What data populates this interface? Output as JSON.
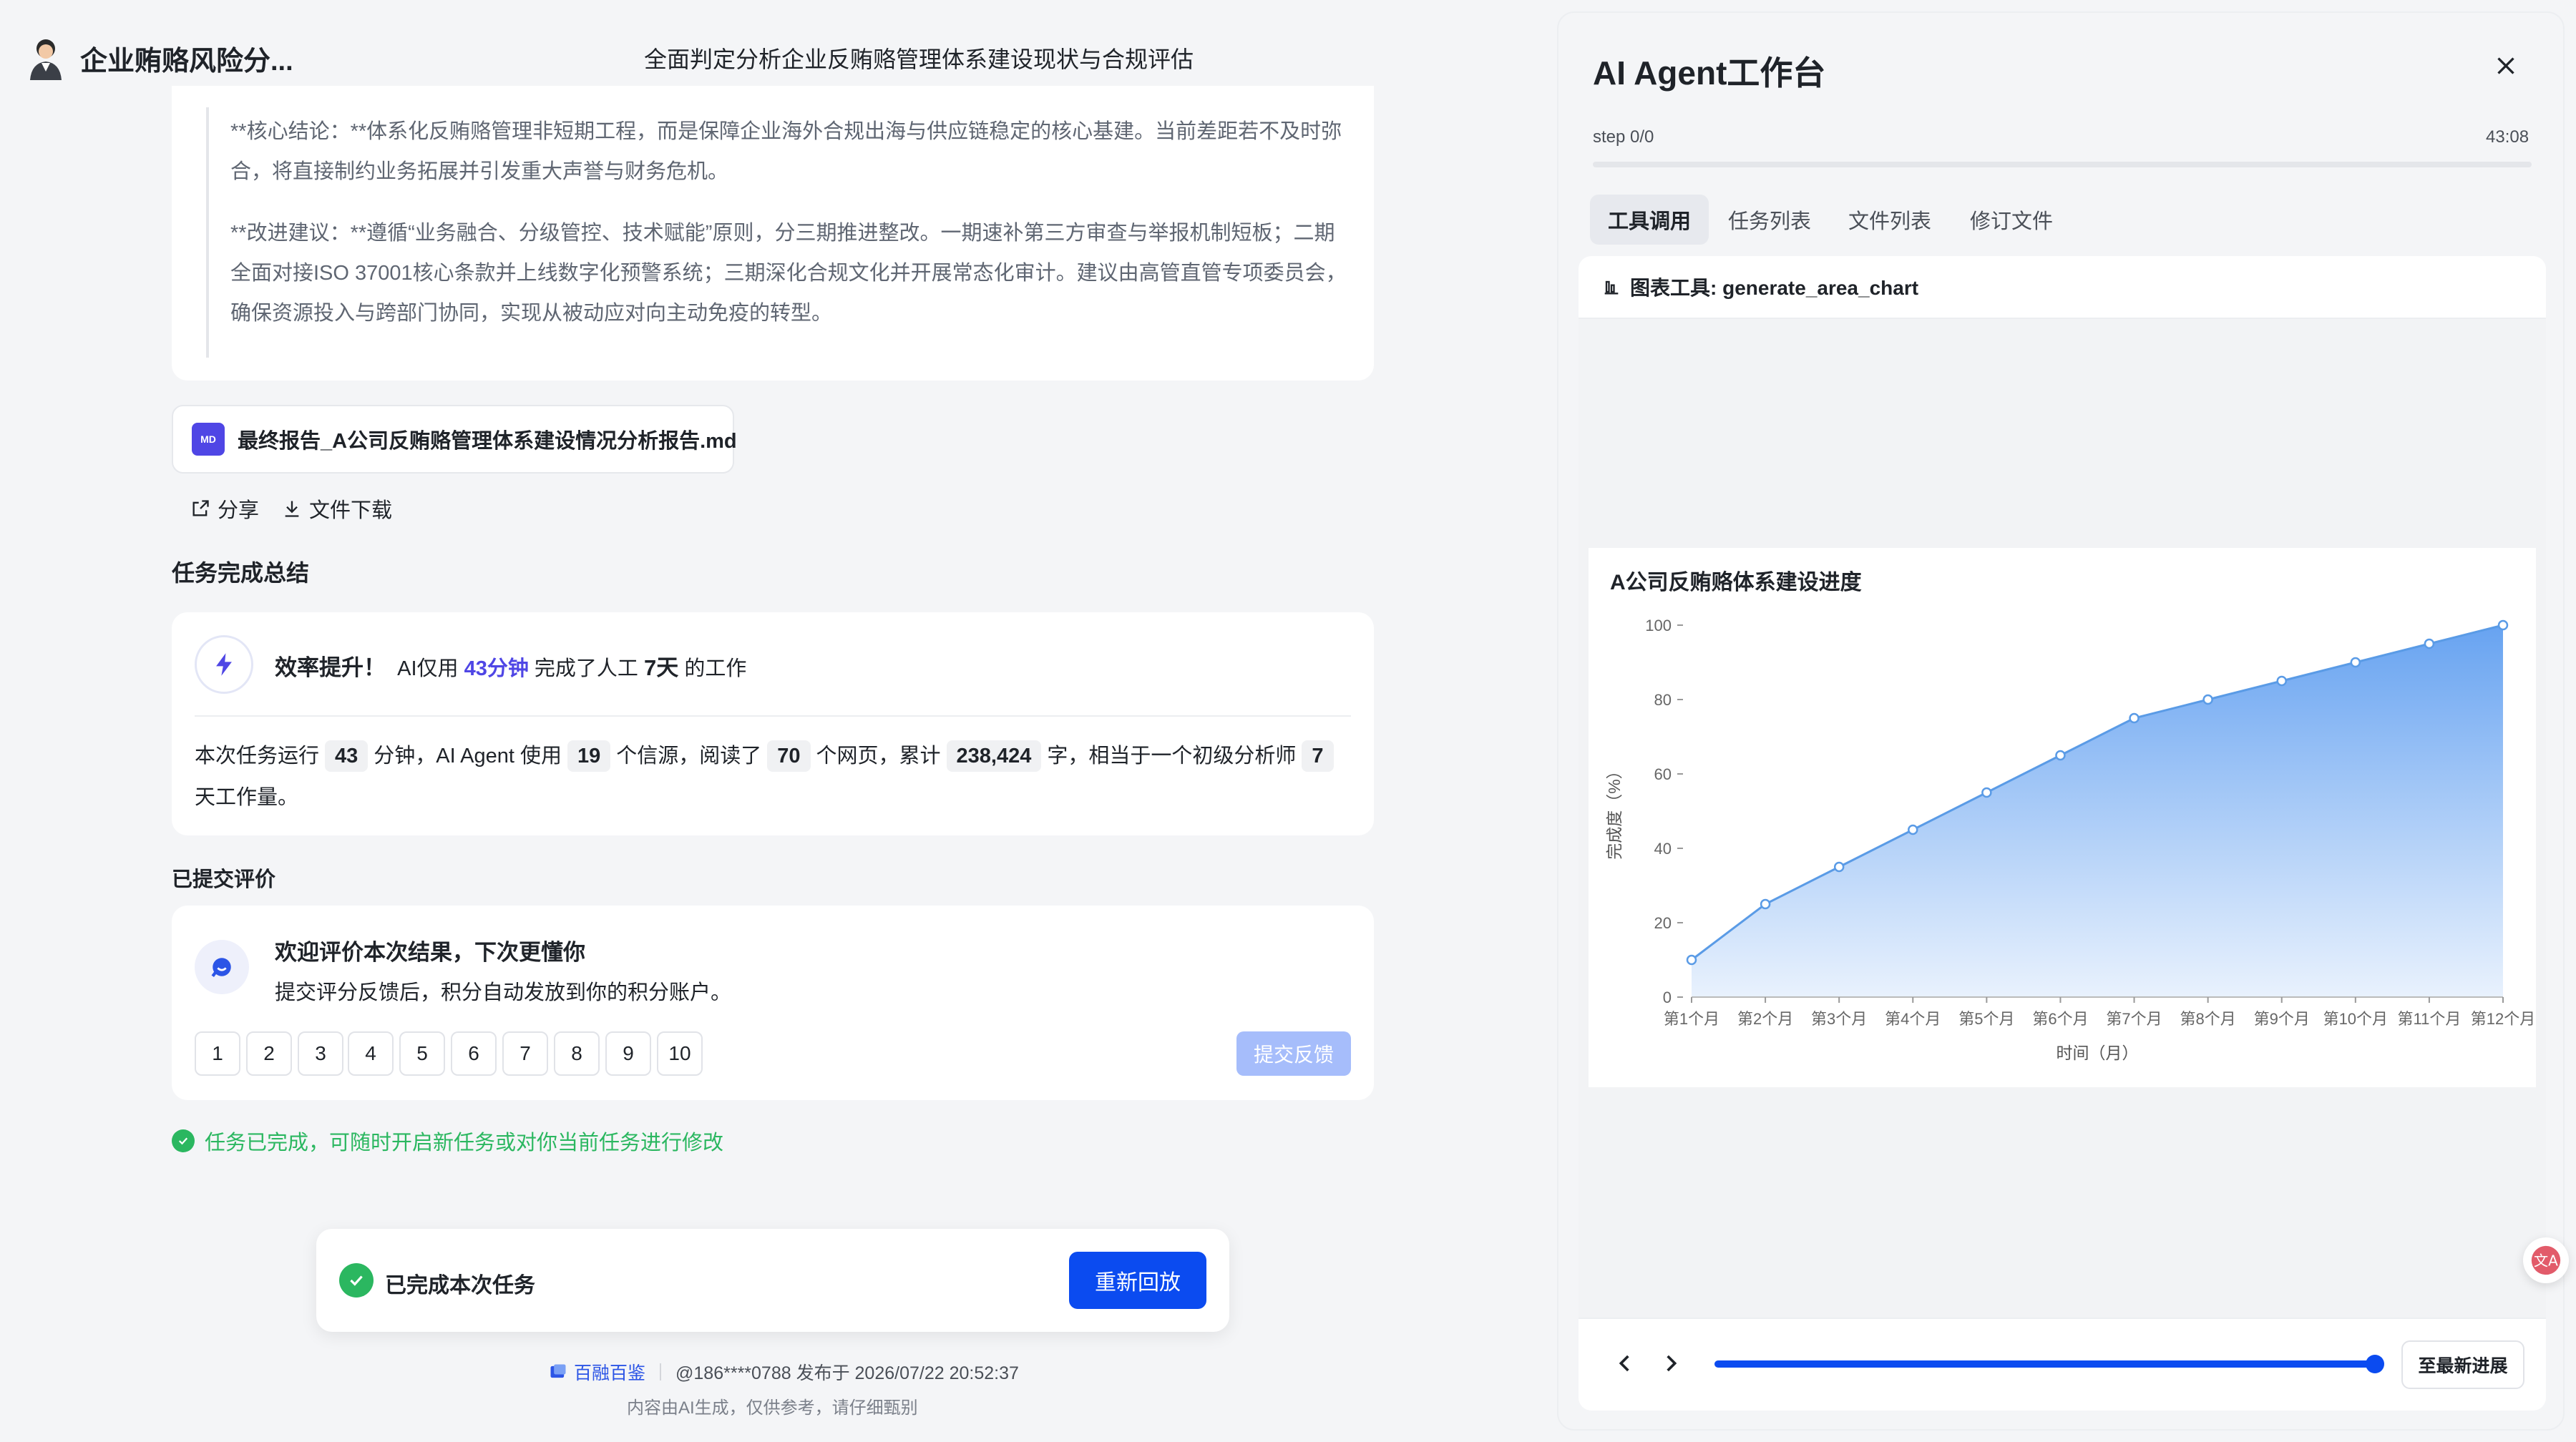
{
  "header": {
    "app_title": "企业贿赂风险分...",
    "title": "全面判定分析企业反贿赂管理体系建设现状与合规评估"
  },
  "conclusion": {
    "para_1": "**核心结论：**体系化反贿赂管理非短期工程，而是保障企业海外合规出海与供应链稳定的核心基建。当前差距若不及时弥合，将直接制约业务拓展并引发重大声誉与财务危机。",
    "para_2": "**改进建议：**遵循“业务融合、分级管控、技术赋能”原则，分三期推进整改。一期速补第三方审查与举报机制短板；二期全面对接ISO 37001核心条款并上线数字化预警系统；三期深化合规文化并开展常态化审计。建议由高管直管专项委员会，确保资源投入与跨部门协同，实现从被动应对向主动免疫的转型。"
  },
  "file": {
    "badge": "MD",
    "name": "最终报告_A公司反贿赂管理体系建设情况分析报告.md"
  },
  "actions": {
    "share": "分享",
    "download": "文件下载"
  },
  "summary": {
    "heading": "任务完成总结",
    "eff_title": "效率提升！",
    "eff_pre": "AI仅用",
    "eff_time": "43分钟",
    "eff_mid": "完成了人工",
    "eff_days": "7天",
    "eff_post": "的工作",
    "s1": "本次任务运行",
    "minutes": "43",
    "s2": "分钟，AI Agent 使用",
    "sources": "19",
    "s3": "个信源，阅读了",
    "pages": "70",
    "s4": "个网页，累计",
    "chars": "238,424",
    "s5": "字，相当于一个初级分析师",
    "analyst_days": "7",
    "s6": "天工作量。"
  },
  "rating": {
    "heading": "已提交评价",
    "title": "欢迎评价本次结果，下次更懂你",
    "subtitle": "提交评分反馈后，积分自动发放到你的积分账户。",
    "scores": [
      "1",
      "2",
      "3",
      "4",
      "5",
      "6",
      "7",
      "8",
      "9",
      "10"
    ],
    "submit": "提交反馈"
  },
  "done_note": "任务已完成，可随时开启新任务或对你当前任务进行修改",
  "done_panel": {
    "text": "已完成本次任务",
    "replay": "重新回放"
  },
  "footer": {
    "brand": "百融百鉴",
    "meta": "@186****0788 发布于 2026/07/22 20:52:37",
    "disclaimer": "内容由AI生成，仅供参考，请仔细甄别"
  },
  "agent": {
    "title": "AI Agent工作台",
    "step": "step 0/0",
    "time": "43:08",
    "tabs": {
      "tools": "工具调用",
      "tasks": "任务列表",
      "files": "文件列表",
      "revise": "修订文件"
    },
    "tool_label": "图表工具: generate_area_chart",
    "latest": "至最新进展"
  },
  "colors": {
    "accent": "#0b4bf0",
    "success": "#2bb760",
    "purple": "#4f46e5",
    "chart_line": "#5a9be6",
    "chart_fill_top": "#6aa6f0"
  },
  "chart_data": {
    "type": "area",
    "title": "A公司反贿赂体系建设进度",
    "xlabel": "时间（月）",
    "ylabel": "完成度（%）",
    "categories": [
      "第1个月",
      "第2个月",
      "第3个月",
      "第4个月",
      "第5个月",
      "第6个月",
      "第7个月",
      "第8个月",
      "第9个月",
      "第10个月",
      "第11个月",
      "第12个月"
    ],
    "values": [
      10,
      25,
      35,
      45,
      55,
      65,
      75,
      80,
      85,
      90,
      95,
      100
    ],
    "ylim": [
      0,
      100
    ],
    "yticks": [
      0,
      20,
      40,
      60,
      80,
      100
    ],
    "grid": false,
    "legend": "none"
  }
}
